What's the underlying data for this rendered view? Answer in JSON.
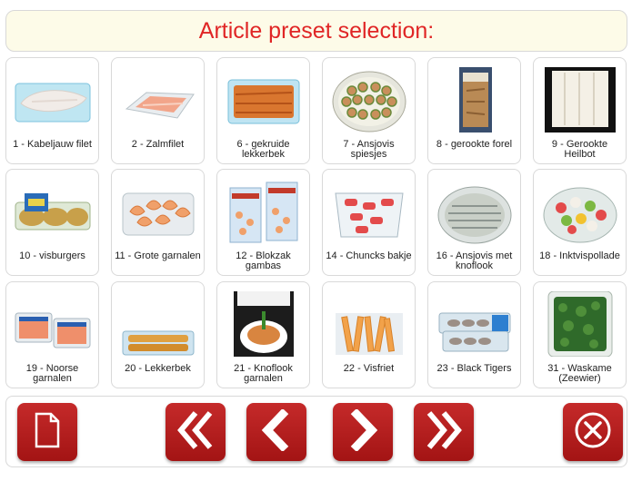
{
  "header": {
    "title": "Article preset selection:"
  },
  "articles": [
    {
      "label": "1 - Kabeljauw filet",
      "icon": "cod-fillet-package"
    },
    {
      "label": "2 - Zalmfilet",
      "icon": "salmon-fillet-tray"
    },
    {
      "label": "6 - gekruide lekkerbek",
      "icon": "spiced-fish-tray"
    },
    {
      "label": "7 - Ansjovis spiesjes",
      "icon": "anchovy-skewers-platter"
    },
    {
      "label": "8 - gerookte forel",
      "icon": "smoked-trout-pack"
    },
    {
      "label": "9 - Gerookte Heilbot",
      "icon": "smoked-halibut-pack"
    },
    {
      "label": "10 - visburgers",
      "icon": "fish-burgers-pack"
    },
    {
      "label": "11 - Grote garnalen",
      "icon": "large-shrimp-tray"
    },
    {
      "label": "12 - Blokzak gambas",
      "icon": "gambas-bags"
    },
    {
      "label": "14 - Chuncks bakje",
      "icon": "surimi-chunks-tub"
    },
    {
      "label": "16 - Ansjovis met knoflook",
      "icon": "anchovy-garlic-platter"
    },
    {
      "label": "18 - Inktvispollade",
      "icon": "squid-salad-bowl"
    },
    {
      "label": "19 - Noorse garnalen",
      "icon": "norwegian-shrimp-trays"
    },
    {
      "label": "20 - Lekkerbek",
      "icon": "breaded-fish-tray"
    },
    {
      "label": "21 - Knoflook garnalen",
      "icon": "garlic-shrimp-box"
    },
    {
      "label": "22 - Visfriet",
      "icon": "fish-fries-box"
    },
    {
      "label": "23 - Black Tigers",
      "icon": "black-tiger-shrimp-trays"
    },
    {
      "label": "31 - Waskame (Zeewier)",
      "icon": "seaweed-tub"
    }
  ],
  "toolbar": {
    "icons": [
      "document-icon",
      "first-page-icon",
      "previous-page-icon",
      "next-page-icon",
      "last-page-icon",
      "close-icon"
    ]
  },
  "colors": {
    "accent": "#b01c1c",
    "title": "#e02525",
    "header_bg": "#fdfbe8"
  }
}
